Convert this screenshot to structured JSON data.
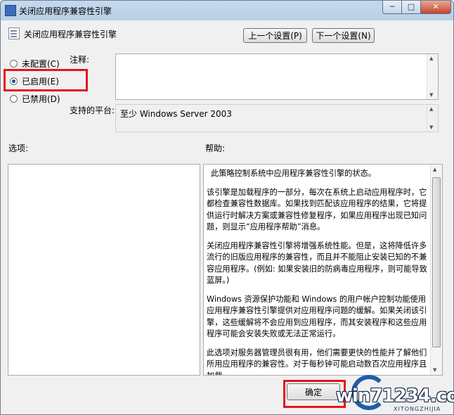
{
  "window": {
    "title": "关闭应用程序兼容性引擎",
    "controls": {
      "minimize": "─",
      "maximize": "□",
      "close": "✕"
    }
  },
  "header": {
    "policy_name": "关闭应用程序兼容性引擎",
    "prev_button": "上一个设置(P)",
    "next_button": "下一个设置(N)"
  },
  "state": {
    "options": [
      {
        "label": "未配置(C)",
        "selected": false
      },
      {
        "label": "已启用(E)",
        "selected": true
      },
      {
        "label": "已禁用(D)",
        "selected": false
      }
    ]
  },
  "comment": {
    "label": "注释:",
    "value": ""
  },
  "platform": {
    "label": "支持的平台:",
    "value": "至少 Windows Server 2003"
  },
  "options_section": {
    "label": "选项:"
  },
  "help_section": {
    "label": "帮助:",
    "paragraphs": [
      "此策略控制系统中应用程序兼容性引擎的状态。",
      "该引擎是加载程序的一部分，每次在系统上启动应用程序时，它都检查兼容性数据库。如果找到匹配该应用程序的结果，它将提供运行时解决方案或兼容性修复程序，如果应用程序出现已知问题，则显示“应用程序帮助”消息。",
      "关闭应用程序兼容性引擎将增强系统性能。但是，这将降低许多流行的旧版应用程序的兼容性，而且并不能阻止安装已知的不兼容应用程序。(例如: 如果安装旧的防病毒应用程序，则可能导致蓝屏。)",
      "Windows 资源保护功能和 Windows 的用户帐户控制功能使用应用程序兼容性引擎提供对应用程序问题的缓解。如果关闭该引擎，这些缓解将不会应用到应用程序，而其安装程序和这些应用程序可能会安装失败或无法正常运行。",
      "此选项对服务器管理员很有用，他们需要更快的性能并了解他们所用应用程序的兼容性。对于每秒钟可能启动数百次应用程序且加载"
    ]
  },
  "footer": {
    "ok_button": "确定"
  },
  "watermark": {
    "text": "win71234.com",
    "subtext": "XITONGZHIJIA"
  }
}
